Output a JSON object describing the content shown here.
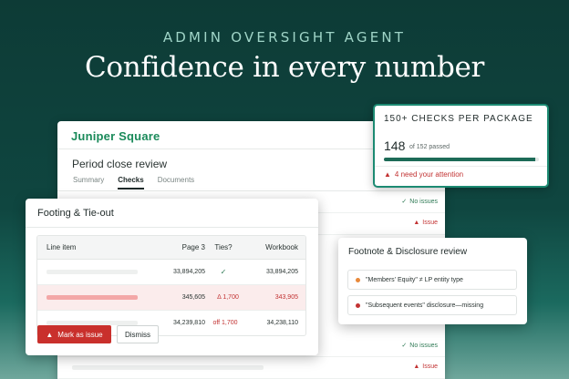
{
  "hero": {
    "eyebrow": "ADMIN OVERSIGHT AGENT",
    "title": "Confidence in every number"
  },
  "main_card": {
    "brand": "Juniper Square",
    "title": "Period close review",
    "tabs": [
      {
        "label": "Summary",
        "active": false
      },
      {
        "label": "Checks",
        "active": true
      },
      {
        "label": "Documents",
        "active": false
      }
    ],
    "rows": [
      {
        "status": "No issues",
        "state": "ok"
      },
      {
        "status": "Issue",
        "state": "bad"
      },
      {
        "status": "No issues",
        "state": "ok"
      },
      {
        "status": "Issue",
        "state": "bad"
      }
    ]
  },
  "checks_card": {
    "title": "150+ CHECKS PER PACKAGE",
    "count": "148",
    "sub": "of 152 passed",
    "progress_fraction": 0.974,
    "attention": "4 need your attention"
  },
  "footing_card": {
    "title": "Footing & Tie-out",
    "columns": [
      "Line item",
      "Page 3",
      "Ties?",
      "Workbook"
    ],
    "rows": [
      {
        "page3": "33,894,205",
        "ties": "✓",
        "workbook": "33,894,205",
        "state": "ok"
      },
      {
        "page3": "345,605",
        "ties": "Δ 1,700",
        "workbook": "343,905",
        "state": "flag"
      },
      {
        "page3": "34,239,810",
        "ties": "off 1,700",
        "workbook": "34,238,110",
        "state": "off"
      }
    ],
    "mark_button": "Mark as issue",
    "dismiss_button": "Dismiss"
  },
  "footnote_card": {
    "title": "Footnote & Disclosure review",
    "items": [
      {
        "text": "\"Members' Equity\" ≠ LP entity type",
        "dot_color": "#e8893a"
      },
      {
        "text": "\"Subsequent events\" disclosure—missing",
        "dot_color": "#c23333"
      }
    ]
  },
  "colors": {
    "accent": "#1c8a72",
    "brand": "#1a8a5a",
    "danger": "#c23333",
    "success": "#2f7a55"
  }
}
